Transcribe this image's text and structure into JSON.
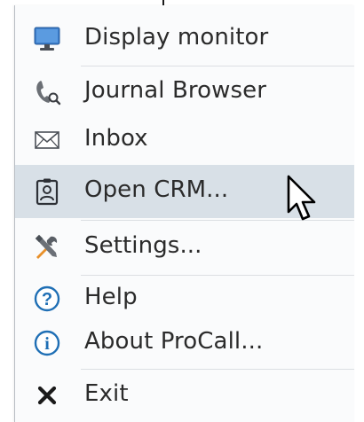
{
  "menu": {
    "items": [
      {
        "label": "Display monitor",
        "icon": "monitor-icon"
      },
      {
        "label": "Journal Browser",
        "icon": "phone-search-icon"
      },
      {
        "label": "Inbox",
        "icon": "envelope-icon"
      },
      {
        "label": "Open CRM...",
        "icon": "id-badge-icon",
        "highlighted": true
      },
      {
        "label": "Settings...",
        "icon": "tools-icon"
      },
      {
        "label": "Help",
        "icon": "help-icon"
      },
      {
        "label": "About ProCall...",
        "icon": "info-icon"
      },
      {
        "label": "Exit",
        "icon": "close-icon"
      }
    ]
  },
  "colors": {
    "highlight": "#d8e0e7",
    "monitor_blue": "#3a7bc8",
    "help_blue": "#1f6fb5",
    "tools_orange": "#e8902a",
    "tools_gray": "#5a5f66"
  }
}
